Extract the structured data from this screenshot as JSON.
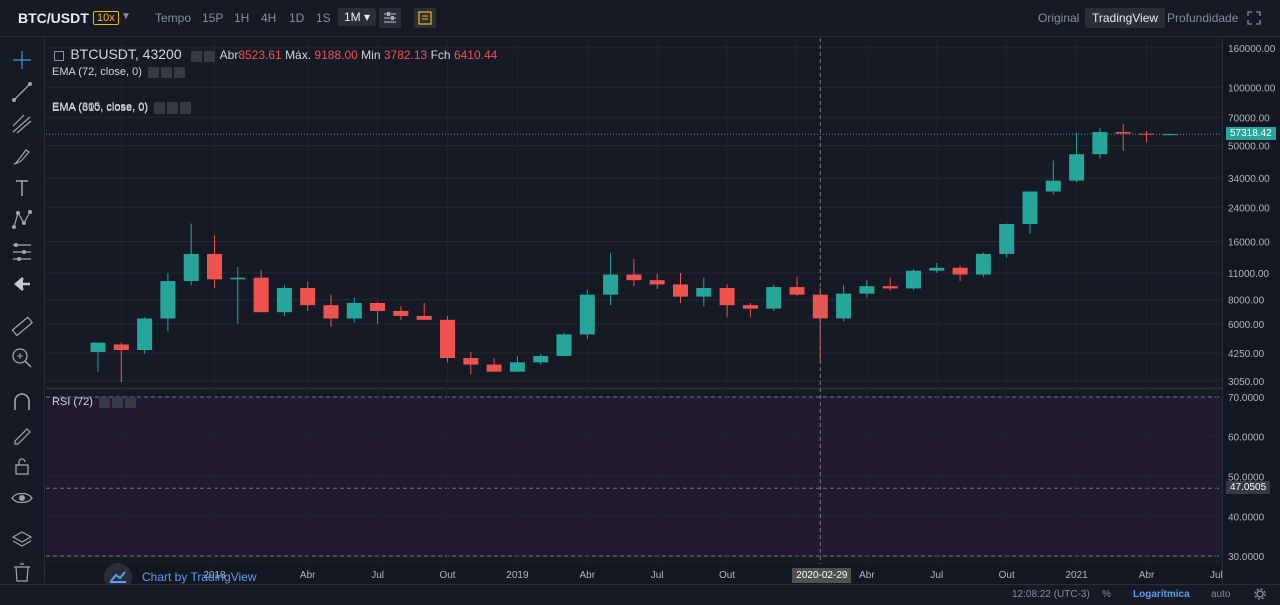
{
  "toolbar": {
    "symbol": "BTC/USDT",
    "leverage": "10x",
    "time_label": "Tempo",
    "timeframes": [
      "15P",
      "1H",
      "4H",
      "1D",
      "1S",
      "1M"
    ],
    "active_timeframe": "1M",
    "views": [
      "Original",
      "TradingView",
      "Profundidade"
    ],
    "active_view": "TradingView"
  },
  "legend": {
    "symbol": "BTCUSDT, 43200",
    "open_label": "Abr",
    "open": "8523.61",
    "high_label": "Máx.",
    "high": "9188.00",
    "low_label": "Min",
    "low": "3782.13",
    "close_label": "Fch",
    "close": "6410.44",
    "emas": [
      "EMA (72, close, 0)",
      "EMA (305, close, 0)",
      "EMA (610, close, 0)"
    ],
    "rsi": "RSI (72)"
  },
  "price_axis": [
    "160000.00",
    "100000.00",
    "70000.00",
    "50000.00",
    "34000.00",
    "24000.00",
    "16000.00",
    "11000.00",
    "8000.00",
    "6000.00",
    "4250.00",
    "3050.00"
  ],
  "rsi_axis": [
    "70.0000",
    "60.0000",
    "50.0000",
    "40.0000",
    "30.0000"
  ],
  "last_price": "57318.42",
  "rsi_value": "47.0505",
  "crosshair_date": "2020-02-29",
  "time_axis": [
    "Ago",
    "2018",
    "Abr",
    "Jul",
    "Out",
    "2019",
    "Abr",
    "Jul",
    "Out",
    "2",
    "Abr",
    "Jul",
    "Out",
    "2021",
    "Abr",
    "Jul"
  ],
  "attribution": "Chart by TradingView",
  "status": {
    "clock": "12:08:22 (UTC-3)",
    "percent": "%",
    "log": "Logarítmica",
    "auto": "auto"
  },
  "colors": {
    "up": "#26a69a",
    "down": "#ef5350",
    "accent": "#f0b90b",
    "link": "#5d9cec"
  },
  "chart_data": {
    "type": "candlestick",
    "title": "BTCUSDT, 43200",
    "scale": "log",
    "ylim": [
      2800,
      180000
    ],
    "rsi_ylim": [
      28,
      72
    ],
    "grid": true,
    "candles": [
      {
        "o": 4300,
        "h": 4700,
        "l": 3400,
        "c": 4800
      },
      {
        "o": 4700,
        "h": 4800,
        "l": 3000,
        "c": 4400
      },
      {
        "o": 4400,
        "h": 6500,
        "l": 4200,
        "c": 6400
      },
      {
        "o": 6400,
        "h": 11000,
        "l": 5500,
        "c": 10000
      },
      {
        "o": 10000,
        "h": 19800,
        "l": 9500,
        "c": 13800
      },
      {
        "o": 13800,
        "h": 17200,
        "l": 9200,
        "c": 10200
      },
      {
        "o": 10200,
        "h": 11800,
        "l": 6000,
        "c": 10400
      },
      {
        "o": 10400,
        "h": 11400,
        "l": 6900,
        "c": 6900
      },
      {
        "o": 6900,
        "h": 9500,
        "l": 6600,
        "c": 9200
      },
      {
        "o": 9200,
        "h": 9900,
        "l": 7000,
        "c": 7500
      },
      {
        "o": 7500,
        "h": 8500,
        "l": 5800,
        "c": 6400
      },
      {
        "o": 6400,
        "h": 8200,
        "l": 6100,
        "c": 7700
      },
      {
        "o": 7700,
        "h": 7800,
        "l": 6000,
        "c": 7000
      },
      {
        "o": 7000,
        "h": 7400,
        "l": 6300,
        "c": 6600
      },
      {
        "o": 6600,
        "h": 7700,
        "l": 6300,
        "c": 6300
      },
      {
        "o": 6300,
        "h": 6600,
        "l": 3800,
        "c": 4000
      },
      {
        "o": 4000,
        "h": 4300,
        "l": 3300,
        "c": 3700
      },
      {
        "o": 3700,
        "h": 4000,
        "l": 3400,
        "c": 3400
      },
      {
        "o": 3400,
        "h": 4100,
        "l": 3400,
        "c": 3800
      },
      {
        "o": 3800,
        "h": 4200,
        "l": 3700,
        "c": 4100
      },
      {
        "o": 4100,
        "h": 5400,
        "l": 4100,
        "c": 5300
      },
      {
        "o": 5300,
        "h": 9000,
        "l": 5000,
        "c": 8500
      },
      {
        "o": 8500,
        "h": 14000,
        "l": 7500,
        "c": 10800
      },
      {
        "o": 10800,
        "h": 13000,
        "l": 9400,
        "c": 10100
      },
      {
        "o": 10100,
        "h": 10900,
        "l": 9100,
        "c": 9600
      },
      {
        "o": 9600,
        "h": 11000,
        "l": 7700,
        "c": 8300
      },
      {
        "o": 8300,
        "h": 10400,
        "l": 7400,
        "c": 9200
      },
      {
        "o": 9200,
        "h": 9600,
        "l": 6500,
        "c": 7500
      },
      {
        "o": 7500,
        "h": 7700,
        "l": 6500,
        "c": 7200
      },
      {
        "o": 7200,
        "h": 9600,
        "l": 7000,
        "c": 9300
      },
      {
        "o": 9300,
        "h": 10500,
        "l": 8400,
        "c": 8500
      },
      {
        "o": 8500,
        "h": 9188,
        "l": 3782,
        "c": 6410
      },
      {
        "o": 6410,
        "h": 9500,
        "l": 6200,
        "c": 8600
      },
      {
        "o": 8600,
        "h": 10100,
        "l": 8200,
        "c": 9400
      },
      {
        "o": 9400,
        "h": 10400,
        "l": 8900,
        "c": 9150
      },
      {
        "o": 9150,
        "h": 11500,
        "l": 9000,
        "c": 11300
      },
      {
        "o": 11300,
        "h": 12400,
        "l": 11000,
        "c": 11700
      },
      {
        "o": 11700,
        "h": 12000,
        "l": 10000,
        "c": 10800
      },
      {
        "o": 10800,
        "h": 14000,
        "l": 10500,
        "c": 13800
      },
      {
        "o": 13800,
        "h": 19800,
        "l": 13200,
        "c": 19700
      },
      {
        "o": 19700,
        "h": 29000,
        "l": 17500,
        "c": 29000
      },
      {
        "o": 29000,
        "h": 41900,
        "l": 28000,
        "c": 33000
      },
      {
        "o": 33000,
        "h": 58300,
        "l": 32300,
        "c": 45200
      },
      {
        "o": 45200,
        "h": 61800,
        "l": 43000,
        "c": 58800
      },
      {
        "o": 58800,
        "h": 64800,
        "l": 47000,
        "c": 57700
      },
      {
        "o": 57700,
        "h": 59500,
        "l": 52000,
        "c": 57300
      },
      {
        "o": 57300,
        "h": 57600,
        "l": 56800,
        "c": 57318.42
      }
    ],
    "rsi": {
      "name": "RSI (72)",
      "upper": 70,
      "lower": 30,
      "last": 47.0505
    }
  }
}
